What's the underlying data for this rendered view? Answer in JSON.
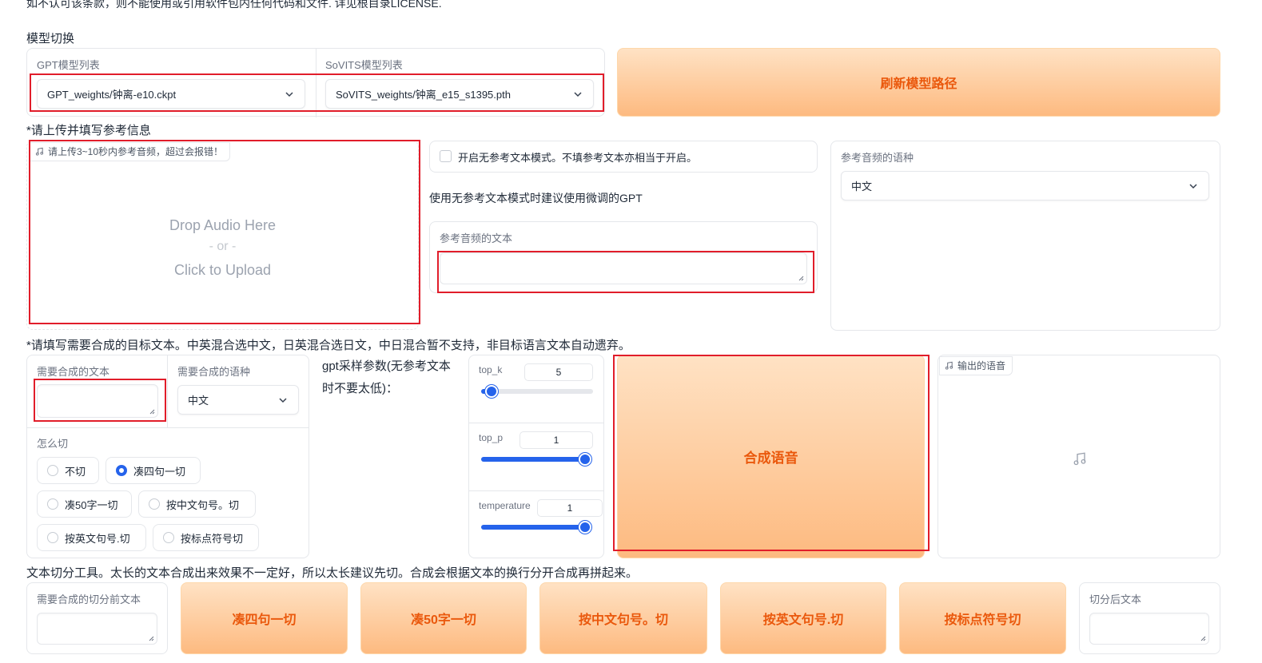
{
  "top_notice": "如不认可该条款，则不能使用或引用软件包内任何代码和文件. 详见根目录LICENSE.",
  "model_section": {
    "title": "模型切换",
    "gpt_label": "GPT模型列表",
    "gpt_value": "GPT_weights/钟离-e10.ckpt",
    "sovits_label": "SoVITS模型列表",
    "sovits_value": "SoVITS_weights/钟离_e15_s1395.pth",
    "refresh_button": "刷新模型路径"
  },
  "reference_section": {
    "title": "*请上传并填写参考信息",
    "audio_tag": "请上传3~10秒内参考音频，超过会报错！",
    "drop_line1": "Drop Audio Here",
    "drop_line2": "- or -",
    "drop_line3": "Click to Upload",
    "no_ref_checkbox": "开启无参考文本模式。不填参考文本亦相当于开启。",
    "no_ref_hint": "使用无参考文本模式时建议使用微调的GPT",
    "ref_text_label": "参考音频的文本",
    "ref_text_value": "",
    "ref_lang_label": "参考音频的语种",
    "ref_lang_value": "中文"
  },
  "synthesis_section": {
    "title": "*请填写需要合成的目标文本。中英混合选中文，日英混合选日文，中日混合暂不支持，非目标语言文本自动遗弃。",
    "target_text_label": "需要合成的文本",
    "target_text_value": "",
    "target_lang_label": "需要合成的语种",
    "target_lang_value": "中文",
    "cut_label": "怎么切",
    "cut_options": [
      "不切",
      "凑四句一切",
      "凑50字一切",
      "按中文句号。切",
      "按英文句号.切",
      "按标点符号切"
    ],
    "cut_selected": "凑四句一切",
    "gpt_params_note": "gpt采样参数(无参考文本时不要太低)：",
    "top_k_label": "top_k",
    "top_k_value": "5",
    "top_k_min": 1,
    "top_k_max": 100,
    "top_p_label": "top_p",
    "top_p_value": "1",
    "top_p_min": 0,
    "top_p_max": 1,
    "temperature_label": "temperature",
    "temperature_value": "1",
    "temperature_min": 0,
    "temperature_max": 1,
    "synth_button": "合成语音",
    "output_tag": "输出的语音",
    "music_icon": "music-note-icon"
  },
  "split_section": {
    "title": "文本切分工具。太长的文本合成出来效果不一定好，所以太长建议先切。合成会根据文本的换行分开合成再拼起来。",
    "before_label": "需要合成的切分前文本",
    "before_value": "",
    "buttons": [
      "凑四句一切",
      "凑50字一切",
      "按中文句号。切",
      "按英文句号.切",
      "按标点符号切"
    ],
    "after_label": "切分后文本",
    "after_value": ""
  },
  "colors": {
    "accent_orange": "#ea580c",
    "button_gradient_top": "#ffe2c4",
    "button_gradient_bottom": "#fdba80",
    "slider_blue": "#2563eb",
    "highlight_red": "#e11d2a"
  }
}
